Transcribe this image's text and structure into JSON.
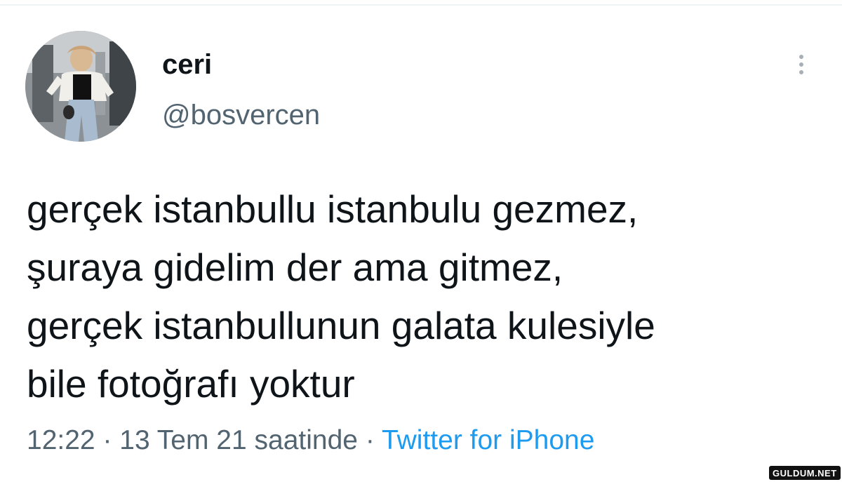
{
  "tweet": {
    "display_name": "ceri",
    "handle": "@bosvercen",
    "text_lines": [
      "gerçek istanbullu istanbulu gezmez,",
      "şuraya gidelim der ama gitmez,",
      "gerçek istanbullunun galata kulesiyle",
      "bile fotoğrafı yoktur"
    ],
    "time": "12:22",
    "separator": " · ",
    "date": "13 Tem 21 saatinde",
    "source": "Twitter for iPhone"
  },
  "icons": {
    "more": "more-vertical-icon"
  },
  "colors": {
    "text": "#0f1419",
    "secondary": "#536471",
    "link": "#1d9bf0"
  },
  "watermark": {
    "text": "GULDUM.NET"
  }
}
